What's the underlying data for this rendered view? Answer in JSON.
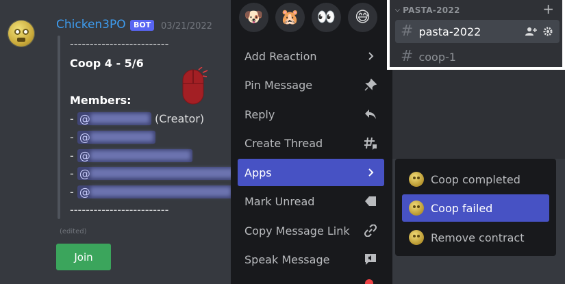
{
  "message": {
    "author": "Chicken3PO",
    "badge": "BOT",
    "timestamp": "03/21/2022",
    "divider": "-------------------------",
    "title": "Coop 4 - 5/6",
    "members_label": "Members:",
    "member_prefix": "- ",
    "at": "@",
    "creator_suffix": "(Creator)",
    "edited": "(edited)",
    "join_label": "Join"
  },
  "context_menu": {
    "reactions": [
      "dog-emoji",
      "hamster-emoji",
      "eyes-emoji",
      "sweat-smile-emoji"
    ],
    "items": [
      {
        "label": "Add Reaction",
        "icon": "chevron-right-icon"
      },
      {
        "label": "Pin Message",
        "icon": "pin-icon"
      },
      {
        "label": "Reply",
        "icon": "reply-icon"
      },
      {
        "label": "Create Thread",
        "icon": "thread-icon"
      },
      {
        "label": "Apps",
        "icon": "chevron-right-icon"
      },
      {
        "label": "Mark Unread",
        "icon": "mark-unread-icon"
      },
      {
        "label": "Copy Message Link",
        "icon": "link-icon"
      },
      {
        "label": "Speak Message",
        "icon": "speak-icon"
      }
    ]
  },
  "apps_submenu": {
    "items": [
      {
        "label": "Coop completed"
      },
      {
        "label": "Coop failed"
      },
      {
        "label": "Remove contract"
      }
    ]
  },
  "channels": {
    "category": "PASTA-2022",
    "items": [
      {
        "name": "pasta-2022"
      },
      {
        "name": "coop-1"
      }
    ]
  },
  "colors": {
    "accent": "#4752c4",
    "author": "#3e9df0",
    "join": "#3ba55c",
    "bot_badge": "#5865f2"
  }
}
